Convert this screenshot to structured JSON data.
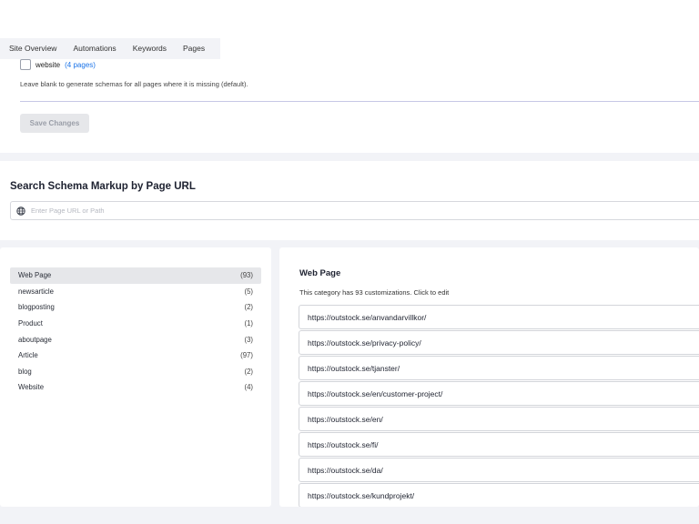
{
  "tabs": [
    {
      "label": "Site Overview"
    },
    {
      "label": "Automations"
    },
    {
      "label": "Keywords"
    },
    {
      "label": "Pages"
    }
  ],
  "settings": {
    "website_label": "website",
    "website_pages_link": "4 pages",
    "hint": "Leave blank to generate schemas for all pages where it is missing (default).",
    "save_label": "Save Changes"
  },
  "search": {
    "title": "Search Schema Markup by Page URL",
    "placeholder": "Enter Page URL or Path"
  },
  "categories": [
    {
      "label": "Web Page",
      "count": "(93)"
    },
    {
      "label": "newsarticle",
      "count": "(5)"
    },
    {
      "label": "blogposting",
      "count": "(2)"
    },
    {
      "label": "Product",
      "count": "(1)"
    },
    {
      "label": "aboutpage",
      "count": "(3)"
    },
    {
      "label": "Article",
      "count": "(97)"
    },
    {
      "label": "blog",
      "count": "(2)"
    },
    {
      "label": "Website",
      "count": "(4)"
    }
  ],
  "detail": {
    "title": "Web Page",
    "subtitle": "This category has 93 customizations. Click to edit",
    "urls": [
      "https://outstock.se/anvandarvillkor/",
      "https://outstock.se/privacy-policy/",
      "https://outstock.se/tjanster/",
      "https://outstock.se/en/customer-project/",
      "https://outstock.se/en/",
      "https://outstock.se/fi/",
      "https://outstock.se/da/",
      "https://outstock.se/kundprojekt/"
    ]
  },
  "icons": {
    "search_field_icon": "globe-icon"
  }
}
